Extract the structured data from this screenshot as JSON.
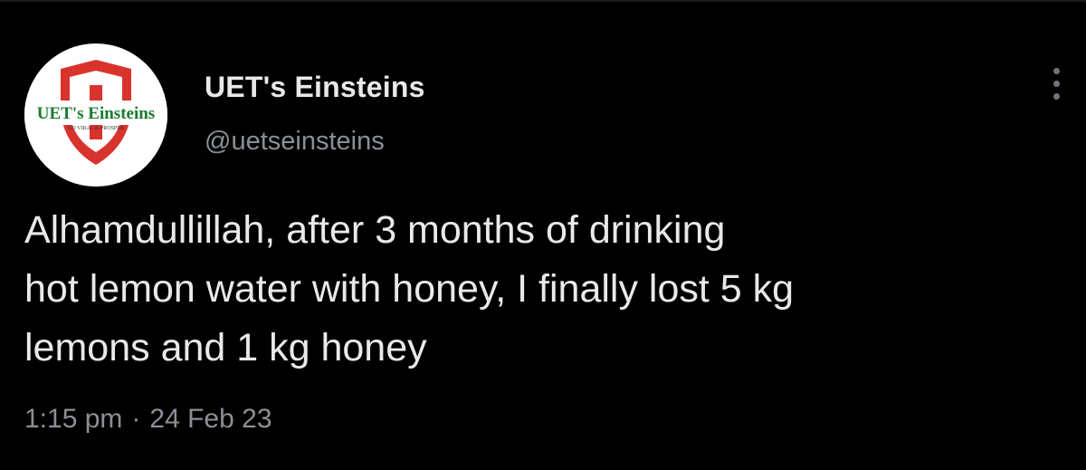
{
  "tweet": {
    "author": {
      "display_name": "UET's Einsteins",
      "handle": "@uetseinsteins",
      "avatar": {
        "logo_text": "UET's Einsteins",
        "logo_tagline": "GO VIRAL & PROSPER",
        "shield_color": "#d8332d",
        "text_color": "#1a7a2e"
      }
    },
    "more_icon": "more-horizontal-icon",
    "text_lines": [
      "Alhamdullillah, after 3 months of drinking",
      "hot lemon water with honey, I finally lost 5 kg",
      "lemons and 1 kg honey"
    ],
    "time": "1:15 pm",
    "separator": "·",
    "date": "24 Feb 23"
  },
  "colors": {
    "background": "#000000",
    "primary_text": "#e7e9ea",
    "secondary_text": "#8b9096"
  }
}
